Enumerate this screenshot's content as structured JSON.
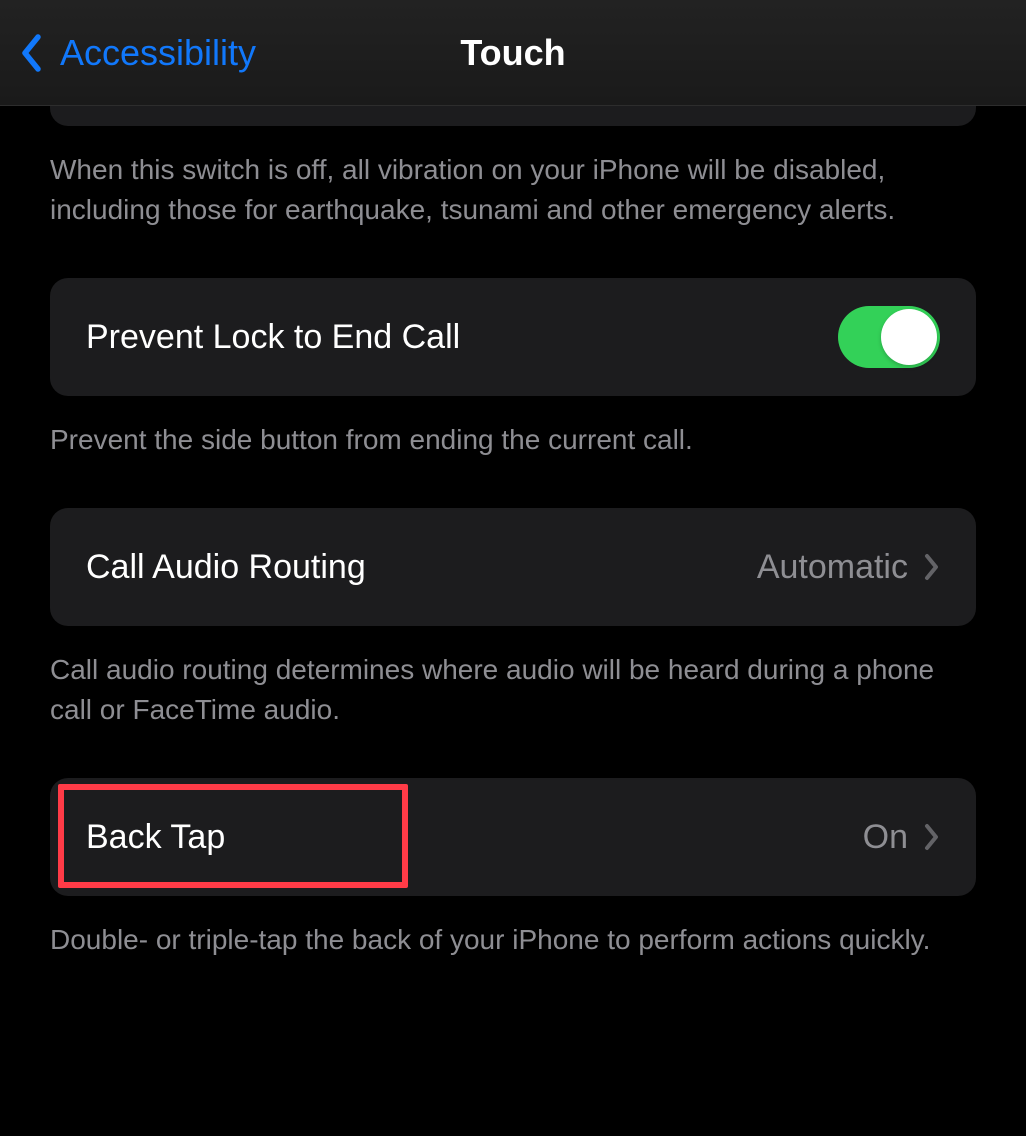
{
  "nav": {
    "back_label": "Accessibility",
    "title": "Touch"
  },
  "sections": {
    "vibration": {
      "footer": "When this switch is off, all vibration on your iPhone will be disabled, including those for earthquake, tsunami and other emergency alerts."
    },
    "prevent_lock": {
      "label": "Prevent Lock to End Call",
      "enabled": true,
      "footer": "Prevent the side button from ending the current call."
    },
    "call_audio": {
      "label": "Call Audio Routing",
      "value": "Automatic",
      "footer": "Call audio routing determines where audio will be heard during a phone call or FaceTime audio."
    },
    "back_tap": {
      "label": "Back Tap",
      "value": "On",
      "footer": "Double- or triple-tap the back of your iPhone to perform actions quickly."
    }
  },
  "highlight": {
    "target": "back_tap_label"
  }
}
